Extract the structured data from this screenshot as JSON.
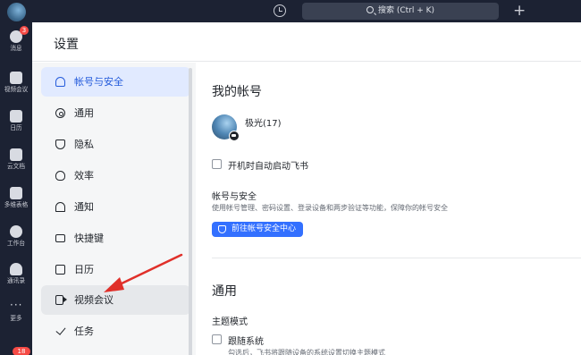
{
  "rail": {
    "items": [
      {
        "label": "消息",
        "badge": "3"
      },
      {
        "label": "视频会议"
      },
      {
        "label": "日历"
      },
      {
        "label": "云文档"
      },
      {
        "label": "多维表格"
      },
      {
        "label": "工作台"
      },
      {
        "label": "通讯录"
      },
      {
        "label": "更多"
      }
    ],
    "bottom_badge": "18"
  },
  "topbar": {
    "search_placeholder": "搜索 (Ctrl + K)",
    "plus": "+"
  },
  "settings": {
    "title": "设置",
    "nav": [
      {
        "label": "帐号与安全",
        "icon": "user-icon"
      },
      {
        "label": "通用",
        "icon": "gear-icon"
      },
      {
        "label": "隐私",
        "icon": "shield-icon"
      },
      {
        "label": "效率",
        "icon": "bulb-icon"
      },
      {
        "label": "通知",
        "icon": "bell-icon"
      },
      {
        "label": "快捷键",
        "icon": "keyboard-icon"
      },
      {
        "label": "日历",
        "icon": "calendar-icon"
      },
      {
        "label": "视频会议",
        "icon": "video-icon"
      },
      {
        "label": "任务",
        "icon": "check-icon"
      }
    ],
    "active_index": 0,
    "hover_index": 7
  },
  "account": {
    "section_title": "我的帐号",
    "username": "极光(17)",
    "autostart_label": "开机时自动启动飞书",
    "security_title": "帐号与安全",
    "security_desc": "使用帐号管理、密码设置、登录设备和两步验证等功能，保障你的帐号安全",
    "security_button": "前往帐号安全中心"
  },
  "general": {
    "section_title": "通用",
    "theme_title": "主题模式",
    "follow_system_label": "跟随系统",
    "follow_system_desc": "勾选后，飞书将跟随设备的系统设置切换主题模式"
  },
  "colors": {
    "accent": "#3370ff",
    "rail_bg": "#1c2233",
    "active_bg": "#e1eaff",
    "arrow": "#e0302a"
  }
}
